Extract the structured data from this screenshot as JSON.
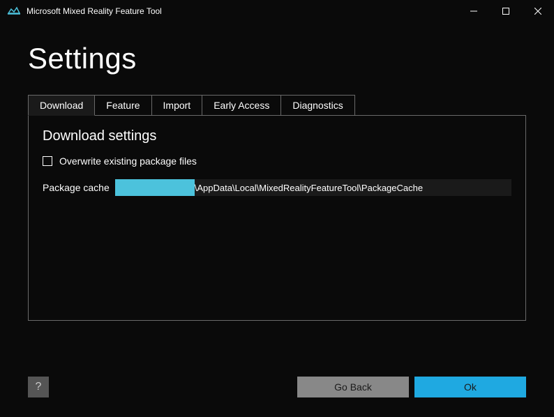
{
  "titlebar": {
    "title": "Microsoft Mixed Reality Feature Tool"
  },
  "page": {
    "title": "Settings"
  },
  "tabs": {
    "items": [
      {
        "label": "Download"
      },
      {
        "label": "Feature"
      },
      {
        "label": "Import"
      },
      {
        "label": "Early Access"
      },
      {
        "label": "Diagnostics"
      }
    ]
  },
  "panel": {
    "heading": "Download settings",
    "overwrite_label": "Overwrite existing package files",
    "cache_label": "Package cache",
    "cache_path_suffix": "\\AppData\\Local\\MixedRealityFeatureTool\\PackageCache"
  },
  "footer": {
    "help": "?",
    "go_back": "Go Back",
    "ok": "Ok"
  }
}
